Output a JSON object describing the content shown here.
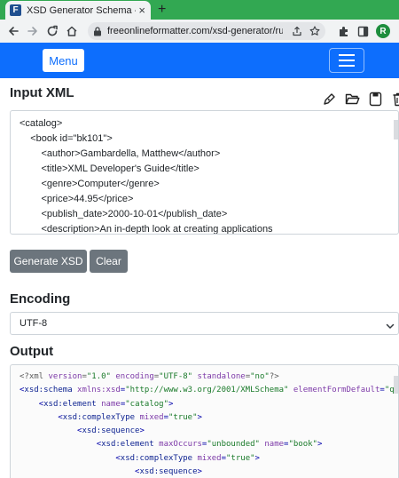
{
  "browser": {
    "tab_title": "XSD Generator Schema - Free Online",
    "tab_close": "×",
    "new_tab": "+",
    "url": "freeonlineformatter.com/xsd-generator/run;j...",
    "profile_initial": "R",
    "favicon_letter": "F"
  },
  "navbar": {
    "menu_label": "Menu"
  },
  "input": {
    "heading": "Input XML",
    "lines": [
      "<catalog>",
      "    <book id=\"bk101\">",
      "        <author>Gambardella, Matthew</author>",
      "        <title>XML Developer's Guide</title>",
      "        <genre>Computer</genre>",
      "        <price>44.95</price>",
      "        <publish_date>2000-10-01</publish_date>",
      "        <description>An in-depth look at creating applications"
    ]
  },
  "actions": {
    "generate_label": "Generate XSD",
    "clear_label": "Clear"
  },
  "encoding": {
    "heading": "Encoding",
    "selected": "UTF-8"
  },
  "output": {
    "heading": "Output",
    "l0": {
      "a": "<?xml ",
      "b": "version",
      "c": "=",
      "d": "\"1.0\"",
      "e": " encoding",
      "f": "=",
      "g": "\"UTF-8\"",
      "h": " standalone",
      "i": "=",
      "j": "\"no\"",
      "k": "?>"
    },
    "l1": {
      "a": "<",
      "b": "xsd:schema",
      "c": " xmlns:xsd",
      "d": "=",
      "e": "\"http://www.w3.org/2001/XMLSchema\"",
      "f": " elementFormDefault",
      "g": "=",
      "h": "\"qu"
    },
    "l2": {
      "indent": "    ",
      "a": "<",
      "b": "xsd:element",
      "c": " name",
      "d": "=",
      "e": "\"catalog\"",
      "f": ">"
    },
    "l3": {
      "indent": "        ",
      "a": "<",
      "b": "xsd:complexType",
      "c": " mixed",
      "d": "=",
      "e": "\"true\"",
      "f": ">"
    },
    "l4": {
      "indent": "            ",
      "a": "<",
      "b": "xsd:sequence",
      "c": ">"
    },
    "l5": {
      "indent": "                ",
      "a": "<",
      "b": "xsd:element",
      "c": " maxOccurs",
      "d": "=",
      "e": "\"unbounded\"",
      "f": " name",
      "g": "=",
      "h": "\"book\"",
      "i": ">"
    },
    "l6": {
      "indent": "                    ",
      "a": "<",
      "b": "xsd:complexType",
      "c": " mixed",
      "d": "=",
      "e": "\"true\"",
      "f": ">"
    },
    "l7": {
      "indent": "                        ",
      "a": "<",
      "b": "xsd:sequence",
      "c": ">"
    }
  },
  "colors": {
    "tabstrip": "#32a852",
    "navbar": "#0d6efd",
    "button": "#6c757d"
  },
  "icons": [
    "back-icon",
    "forward-icon",
    "reload-icon",
    "lock-icon",
    "share-icon",
    "star-icon",
    "extensions-icon",
    "sidepanel-icon",
    "pen-icon",
    "folder-open-icon",
    "save-icon",
    "trash-icon",
    "chevron-down-icon",
    "hamburger-icon"
  ]
}
